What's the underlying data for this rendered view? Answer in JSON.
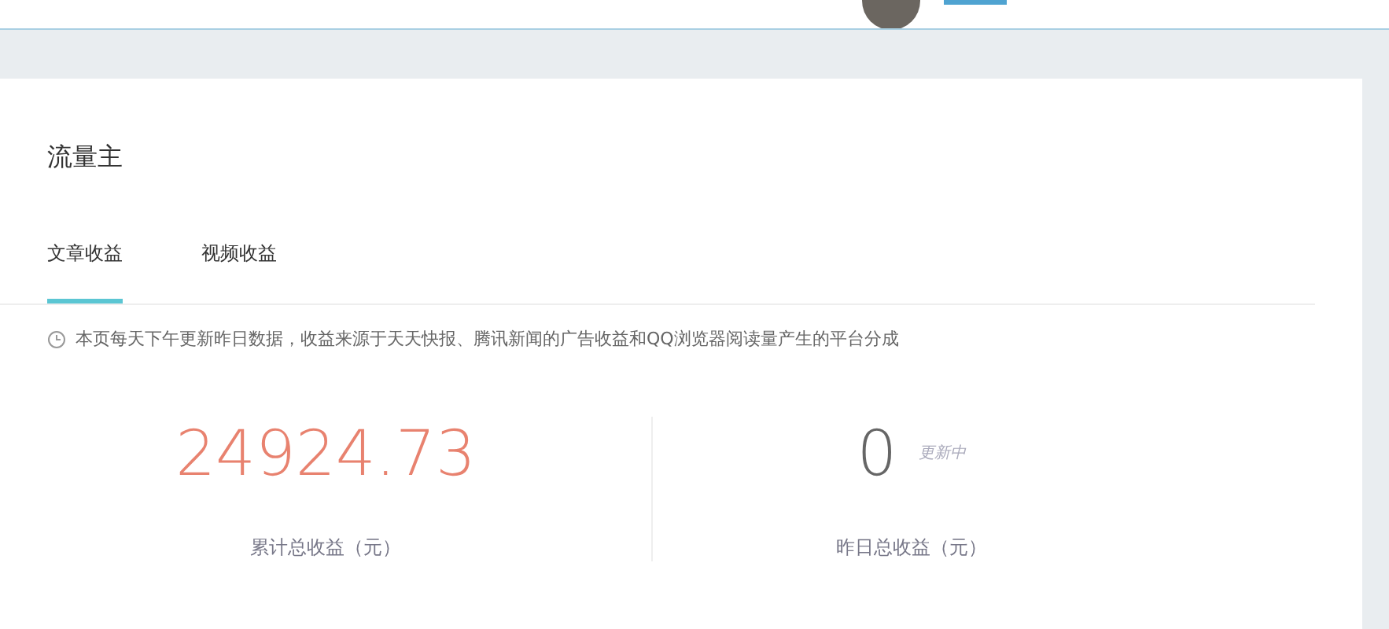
{
  "card": {
    "title": "流量主",
    "tabs": [
      {
        "label": "文章收益",
        "selected": true
      },
      {
        "label": "视频收益",
        "selected": false
      }
    ],
    "notice": "本页每天下午更新昨日数据，收益来源于天天快报、腾讯新闻的广告收益和QQ浏览器阅读量产生的平台分成",
    "stats": [
      {
        "value": "24924.73",
        "kind": "highlight",
        "label": "累计总收益（元）"
      },
      {
        "value": "0",
        "kind": "normal",
        "status": "更新中",
        "label": "昨日总收益（元）"
      }
    ]
  }
}
